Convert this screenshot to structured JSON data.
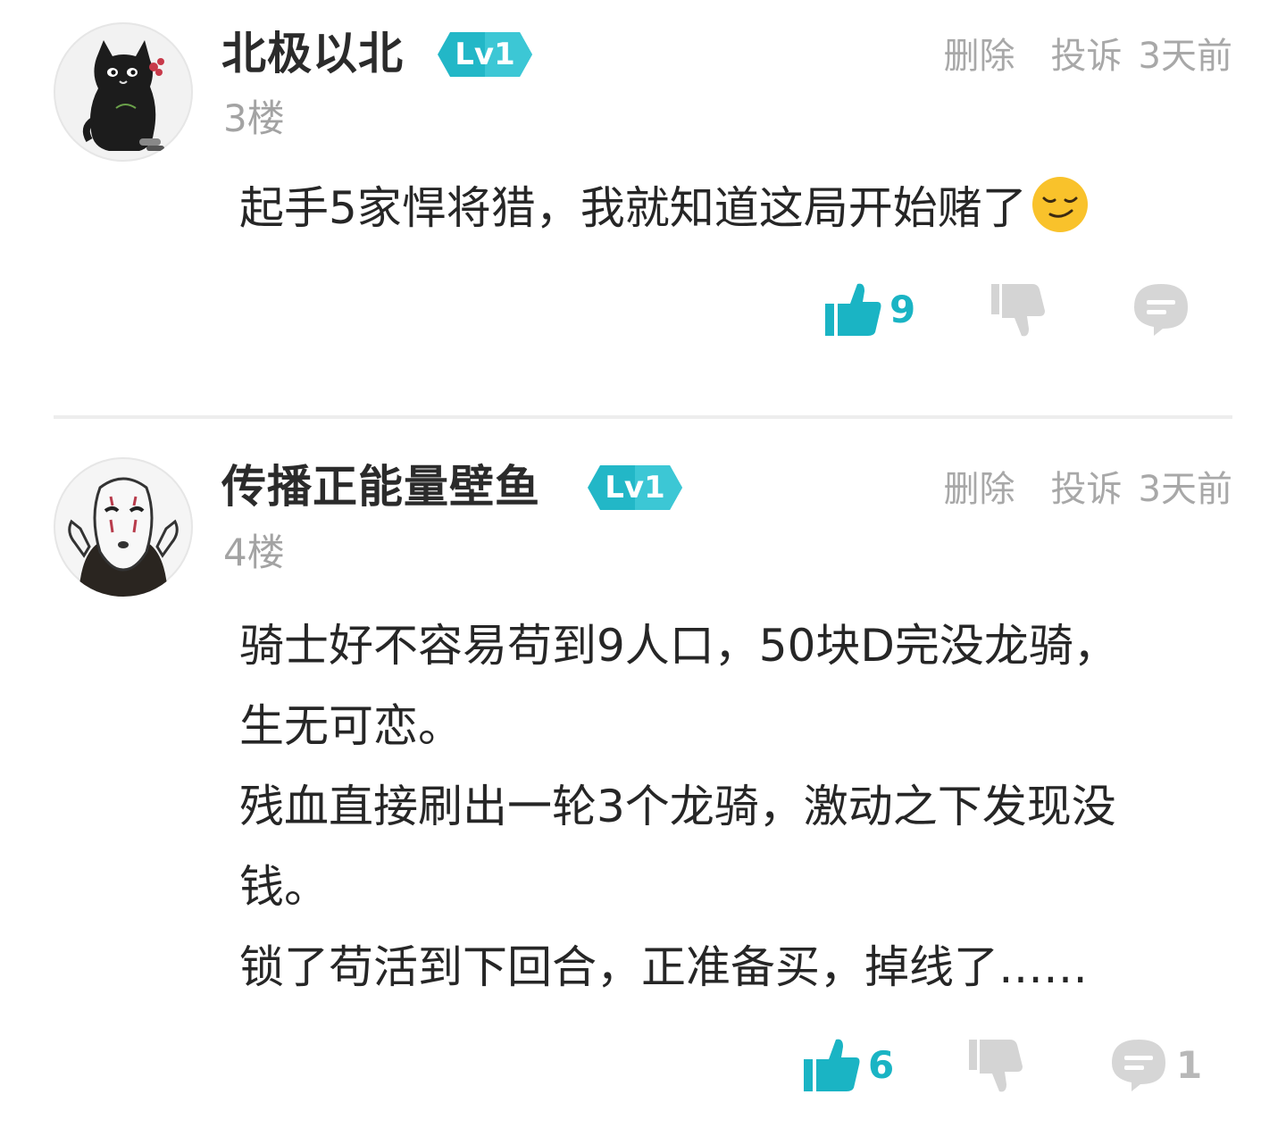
{
  "comments": [
    {
      "username": "北极以北",
      "level": "Lv1",
      "floor": "3楼",
      "delete_label": "删除",
      "report_label": "投诉",
      "time": "3天前",
      "avatar_icon": "black-cat-avatar-icon",
      "content_lines": [
        "起手5家悍将猎，我就知道这局开始赌了"
      ],
      "emoji": "smirk-emoji-icon",
      "likes": "9",
      "replies": ""
    },
    {
      "username": "传播正能量壁鱼",
      "level": "Lv1",
      "floor": "4楼",
      "delete_label": "删除",
      "report_label": "投诉",
      "time": "3天前",
      "avatar_icon": "no-face-avatar-icon",
      "content_lines": [
        "骑士好不容易苟到9人口，50块D完没龙骑，",
        "生无可恋。",
        "残血直接刷出一轮3个龙骑，激动之下发现没",
        "钱。",
        "锁了苟活到下回合，正准备买，掉线了……"
      ],
      "likes": "6",
      "replies": "1"
    }
  ],
  "colors": {
    "accent": "#1ab4c4",
    "badge": "#22b7c7",
    "muted": "#a8a8a8",
    "divider": "#ededed"
  }
}
